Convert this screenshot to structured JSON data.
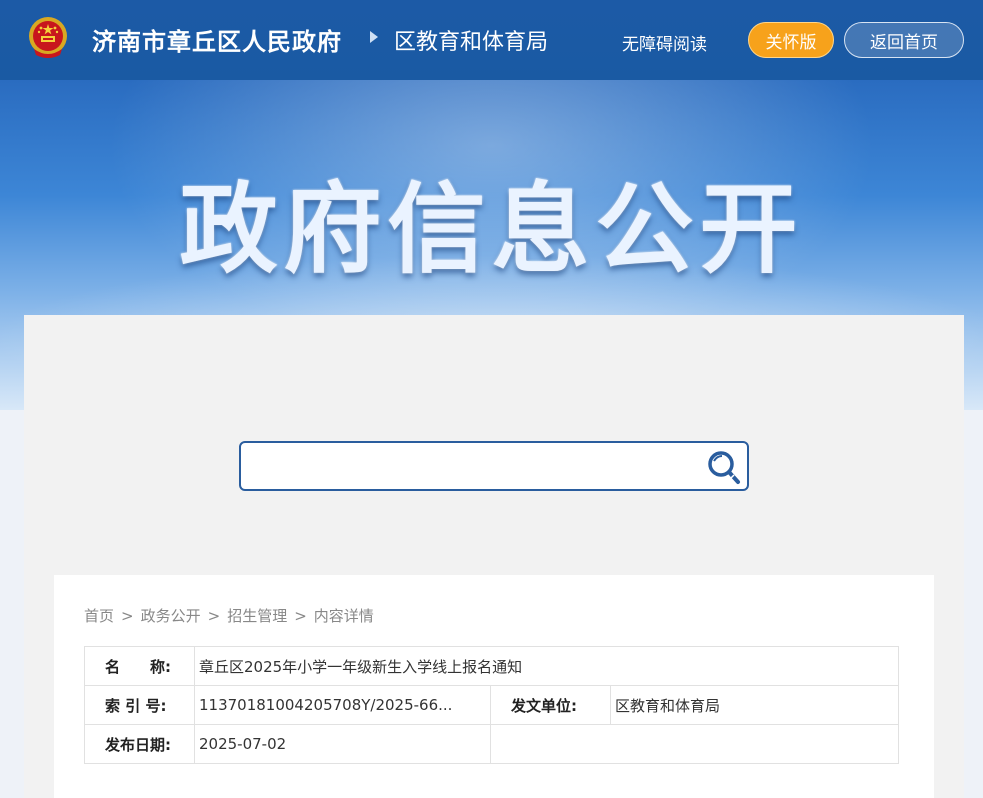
{
  "header": {
    "site_name": "济南市章丘区人民政府",
    "dept_name": "区教育和体育局",
    "accessible_label": "无障碍阅读",
    "care_label": "关怀版",
    "home_label": "返回首页",
    "accent_color": "#f7a21b",
    "bar_color": "#1a5aa3"
  },
  "banner": {
    "title": "政府信息公开"
  },
  "search": {
    "placeholder": "",
    "icon": "search-icon"
  },
  "breadcrumb": {
    "items": [
      "首页",
      "政务公开",
      "招生管理",
      "内容详情"
    ],
    "separator": ">"
  },
  "info": {
    "name_label": "名　　称:",
    "name_value": "章丘区2025年小学一年级新生入学线上报名通知",
    "index_label": "索 引 号:",
    "index_value": "11370181004205708Y/2025-66...",
    "issuer_label": "发文单位:",
    "issuer_value": "区教育和体育局",
    "date_label": "发布日期:",
    "date_value": "2025-07-02"
  }
}
